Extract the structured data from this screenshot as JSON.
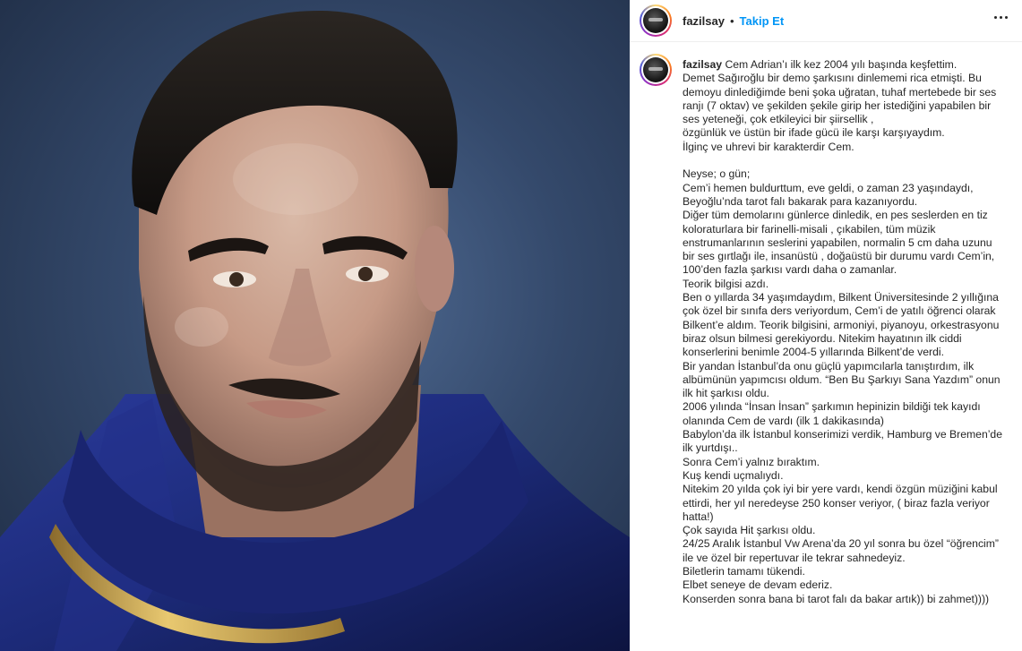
{
  "post": {
    "username": "fazilsay",
    "separator": "•",
    "follow_label": "Takip Et",
    "caption_lines": [
      "Cem Adrian’ı ilk kez 2004 yılı başında keşfettim.",
      "Demet Sağıroğlu bir demo şarkısını dinlememi rica etmişti. Bu demoyu dinlediğimde beni şoka uğratan, tuhaf mertebede bir ses ranjı (7 oktav) ve şekilden şekile girip her istediğini yapabilen bir ses yeteneği, çok etkileyici bir şiirsellik ,",
      "özgünlük ve üstün bir ifade gücü ile karşı karşıyaydım.",
      "İlginç ve uhrevi bir karakterdir Cem.",
      "",
      "Neyse; o gün;",
      "Cem’i hemen buldurttum, eve geldi, o zaman 23 yaşındaydı, Beyoğlu’nda tarot falı bakarak para kazanıyordu.",
      "Diğer tüm demolarını günlerce dinledik, en pes seslerden en tiz koloraturlara bir farinelli-misali , çıkabilen, tüm müzik enstrumanlarının seslerini yapabilen, normalin 5 cm daha uzunu bir ses gırtlağı ile, insanüstü , doğaüstü bir durumu vardı Cem’in, 100’den fazla şarkısı vardı daha o zamanlar.",
      "Teorik bilgisi azdı.",
      "Ben o yıllarda 34 yaşımdaydım, Bilkent Üniversitesinde 2 yıllığına çok özel bir sınıfa ders veriyordum, Cem’i de yatılı öğrenci olarak Bilkent’e aldım. Teorik bilgisini, armoniyi, piyanoyu, orkestrasyonu biraz olsun bilmesi gerekiyordu. Nitekim hayatının ilk ciddi konserlerini benimle 2004-5 yıllarında Bilkent’de verdi.",
      "Bir yandan İstanbul’da onu güçlü yapımcılarla tanıştırdım, ilk albümünün yapımcısı oldum. “Ben Bu Şarkıyı Sana Yazdım” onun ilk hit şarkısı oldu.",
      "2006 yılında “İnsan İnsan” şarkımın hepinizin bildiği tek kayıdı olanında Cem de vardı (ilk 1 dakikasında)",
      "Babylon’da ilk İstanbul konserimizi verdik, Hamburg ve Bremen’de ilk yurtdışı..",
      "Sonra Cem’i yalnız bıraktım.",
      "Kuş kendi uçmalıydı.",
      "Nitekim 20 yılda çok iyi bir yere vardı, kendi özgün müziğini kabul ettirdi, her yıl neredeyse 250 konser veriyor, ( biraz fazla veriyor hatta!)",
      "Çok sayıda Hit şarkısı oldu.",
      "24/25 Aralık İstanbul Vw Arena’da 20 yıl sonra bu özel “öğrencim” ile ve özel bir repertuvar ile tekrar sahnedeyiz.",
      "Biletlerin tamamı tükendi.",
      "Elbet seneye de devam ederiz.",
      "Konserden sonra bana bi tarot falı da bakar artık)) bi zahmet))))"
    ]
  },
  "colors": {
    "follow_blue": "#0095f6",
    "text": "#262626",
    "photo_background": "#34496b",
    "jacket": "#1c2a78",
    "necklace": "#c9a24a"
  }
}
